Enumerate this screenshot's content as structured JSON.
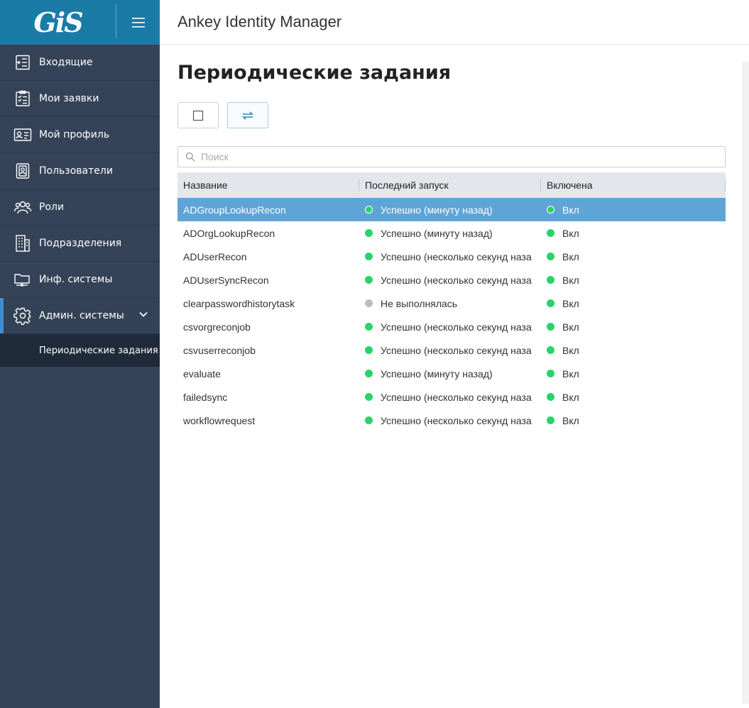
{
  "brand": {
    "logo_text": "GiS"
  },
  "header": {
    "app_title": "Ankey Identity Manager"
  },
  "sidebar": {
    "items": [
      {
        "label": "Входящие",
        "icon": "inbox-icon"
      },
      {
        "label": "Мои заявки",
        "icon": "checklist-icon"
      },
      {
        "label": "Мой профиль",
        "icon": "id-card-icon"
      },
      {
        "label": "Пользователи",
        "icon": "user-badge-icon"
      },
      {
        "label": "Роли",
        "icon": "users-group-icon"
      },
      {
        "label": "Подразделения",
        "icon": "building-icon"
      },
      {
        "label": "Инф. системы",
        "icon": "folder-network-icon"
      },
      {
        "label": "Админ. системы",
        "icon": "gear-icon",
        "active": true
      }
    ],
    "sub_items": [
      {
        "label": "Периодические задания"
      }
    ]
  },
  "main": {
    "page_title": "Периодические задания",
    "search": {
      "placeholder": "Поиск",
      "value": ""
    },
    "table": {
      "columns": [
        "Название",
        "Последний запуск",
        "Включена"
      ],
      "rows": [
        {
          "name": "ADGroupLookupRecon",
          "status": "ok",
          "last_run": "Успешно (минуту назад)",
          "enabled": "Вкл",
          "selected": true
        },
        {
          "name": "ADOrgLookupRecon",
          "status": "ok",
          "last_run": "Успешно (минуту назад)",
          "enabled": "Вкл"
        },
        {
          "name": "ADUserRecon",
          "status": "ok",
          "last_run": "Успешно (несколько секунд наза",
          "enabled": "Вкл"
        },
        {
          "name": "ADUserSyncRecon",
          "status": "ok",
          "last_run": "Успешно (несколько секунд наза",
          "enabled": "Вкл"
        },
        {
          "name": "clearpasswordhistorytask",
          "status": "gray",
          "last_run": "Не выполнялась",
          "enabled": "Вкл"
        },
        {
          "name": "csvorgreconjob",
          "status": "ok",
          "last_run": "Успешно (несколько секунд наза",
          "enabled": "Вкл"
        },
        {
          "name": "csvuserreconjob",
          "status": "ok",
          "last_run": "Успешно (несколько секунд наза",
          "enabled": "Вкл"
        },
        {
          "name": "evaluate",
          "status": "ok",
          "last_run": "Успешно (минуту назад)",
          "enabled": "Вкл"
        },
        {
          "name": "failedsync",
          "status": "ok",
          "last_run": "Успешно (несколько секунд наза",
          "enabled": "Вкл"
        },
        {
          "name": "workflowrequest",
          "status": "ok",
          "last_run": "Успешно (несколько секунд наза",
          "enabled": "Вкл"
        }
      ]
    }
  },
  "colors": {
    "sidebar_bg": "#344358",
    "brand_bg": "#1a7ba7",
    "accent": "#3d8fd1",
    "selected_row": "#5fa4d6",
    "status_ok": "#2bd26a",
    "status_idle": "#bcbcbc"
  }
}
